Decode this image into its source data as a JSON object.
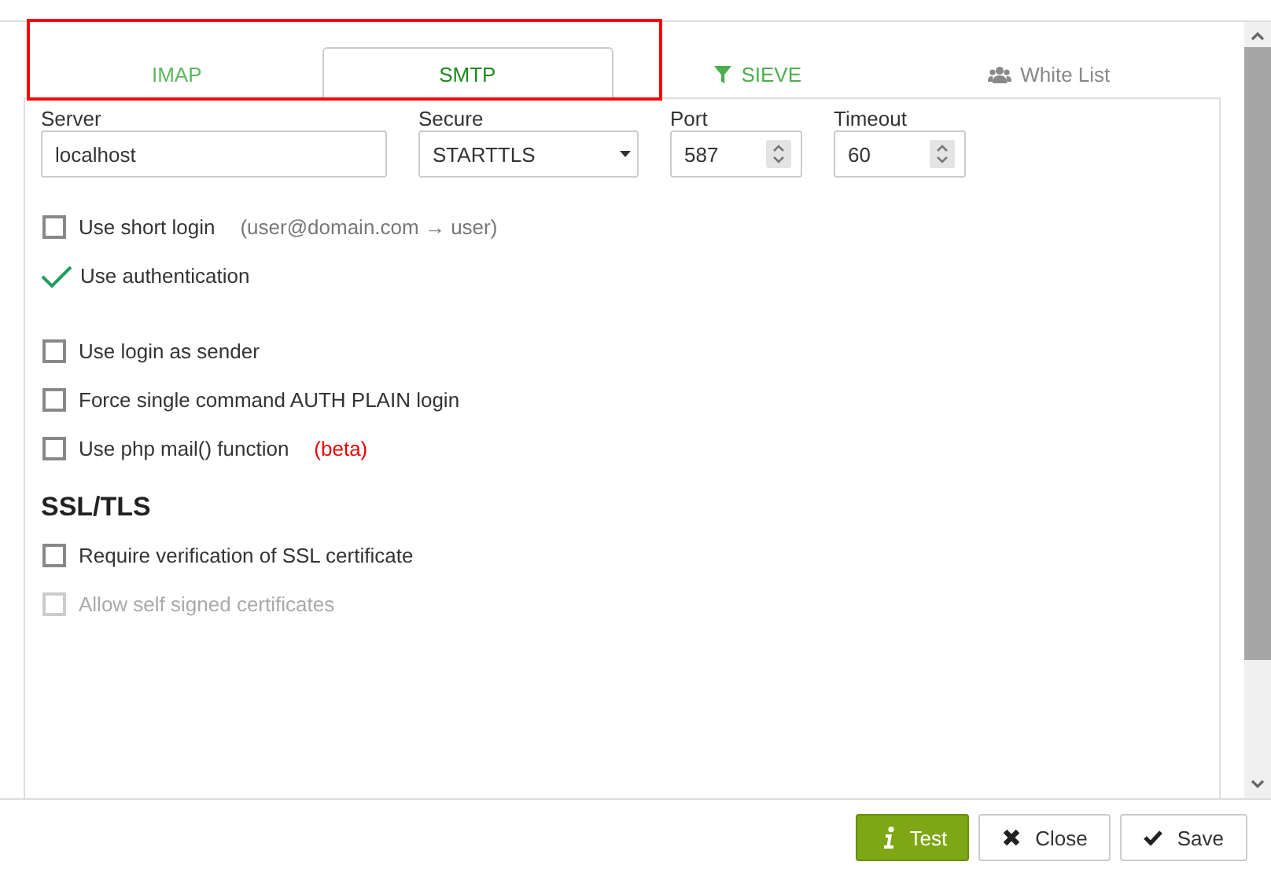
{
  "tabs": [
    {
      "label": "IMAP",
      "selected": false,
      "highlighted": true,
      "color": "#5cb85c"
    },
    {
      "label": "SMTP",
      "selected": true,
      "highlighted": true,
      "color": "#1e8a1e"
    },
    {
      "label": "SIEVE",
      "selected": false,
      "highlighted": false,
      "color": "#4cae4c"
    },
    {
      "label": "White List",
      "selected": false,
      "highlighted": false,
      "color": "#888888"
    }
  ],
  "fields": [
    {
      "label": "Server",
      "kind": "text",
      "value": "localhost"
    },
    {
      "label": "Secure",
      "kind": "select",
      "value": "STARTTLS"
    },
    {
      "label": "Port",
      "kind": "number",
      "value": "587"
    },
    {
      "label": "Timeout",
      "kind": "number",
      "value": "60"
    }
  ],
  "option_groups": [
    [
      {
        "label": "Use short login",
        "note": "(user@domain.com → user)",
        "kind": "hint",
        "checked": false,
        "disabled": false
      },
      {
        "label": "Use authentication",
        "kind": "plain",
        "checked": true,
        "disabled": false
      }
    ],
    [
      {
        "label": "Use login as sender",
        "kind": "plain",
        "checked": false,
        "disabled": false
      },
      {
        "label": "Force single command AUTH PLAIN login",
        "kind": "plain",
        "checked": false,
        "disabled": false
      },
      {
        "label": "Use php mail() function",
        "note": "(beta)",
        "kind": "warning",
        "checked": false,
        "disabled": false
      }
    ]
  ],
  "ssl": {
    "heading": "SSL/TLS",
    "options": [
      {
        "label": "Require verification of SSL certificate",
        "kind": "plain",
        "checked": false,
        "disabled": false
      },
      {
        "label": "Allow self signed certificates",
        "kind": "plain",
        "checked": false,
        "disabled": true
      }
    ]
  },
  "buttons": [
    {
      "label": "Test",
      "kind": "primary"
    },
    {
      "label": "Close",
      "kind": "default"
    },
    {
      "label": "Save",
      "kind": "default"
    }
  ]
}
